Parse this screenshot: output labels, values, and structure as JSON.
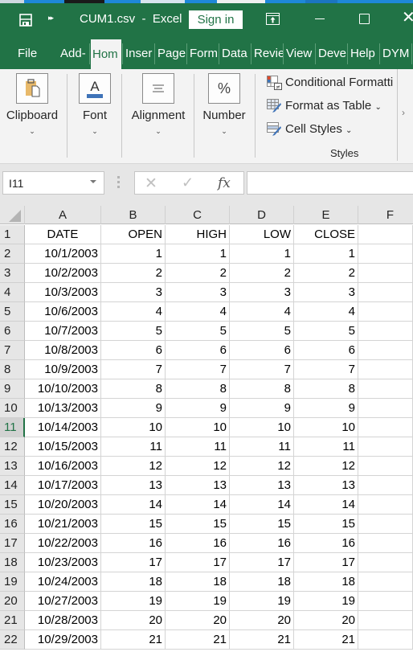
{
  "window": {
    "title": "CUM1.csv  -  Excel",
    "sign_in_label": "Sign in",
    "accent_color": "#217346"
  },
  "tabs": [
    {
      "label": "File",
      "active": false
    },
    {
      "label": "Add-",
      "active": false
    },
    {
      "label": "Hom",
      "active": true
    },
    {
      "label": "Inser",
      "active": false
    },
    {
      "label": "Page",
      "active": false
    },
    {
      "label": "Form",
      "active": false
    },
    {
      "label": "Data",
      "active": false
    },
    {
      "label": "Revie",
      "active": false
    },
    {
      "label": "View",
      "active": false
    },
    {
      "label": "Deve",
      "active": false
    },
    {
      "label": "Help",
      "active": false
    },
    {
      "label": "DYM",
      "active": false
    }
  ],
  "ribbon": {
    "groups": [
      {
        "label": "Clipboard",
        "icon": "clipboard-icon"
      },
      {
        "label": "Font",
        "icon": "font-color-icon"
      },
      {
        "label": "Alignment",
        "icon": "align-center-icon"
      },
      {
        "label": "Number",
        "icon": "percent-icon"
      }
    ],
    "styles": {
      "items": [
        {
          "label": "Conditional Formatti",
          "icon": "conditional-formatting-icon",
          "dropdown": false
        },
        {
          "label": "Format as Table",
          "icon": "format-as-table-icon",
          "dropdown": true
        },
        {
          "label": "Cell Styles",
          "icon": "cell-styles-icon",
          "dropdown": true
        }
      ],
      "group_label": "Styles"
    }
  },
  "formula_bar": {
    "name_box": "I11",
    "formula": "",
    "fx_label": "fx"
  },
  "sheet": {
    "columns": [
      "A",
      "B",
      "C",
      "D",
      "E",
      "F"
    ],
    "active_row": 11,
    "rows": [
      {
        "n": "1",
        "cells": [
          "DATE",
          "OPEN",
          "HIGH",
          "LOW",
          "CLOSE",
          ""
        ]
      },
      {
        "n": "2",
        "cells": [
          "10/1/2003",
          "1",
          "1",
          "1",
          "1",
          ""
        ]
      },
      {
        "n": "3",
        "cells": [
          "10/2/2003",
          "2",
          "2",
          "2",
          "2",
          ""
        ]
      },
      {
        "n": "4",
        "cells": [
          "10/3/2003",
          "3",
          "3",
          "3",
          "3",
          ""
        ]
      },
      {
        "n": "5",
        "cells": [
          "10/6/2003",
          "4",
          "4",
          "4",
          "4",
          ""
        ]
      },
      {
        "n": "6",
        "cells": [
          "10/7/2003",
          "5",
          "5",
          "5",
          "5",
          ""
        ]
      },
      {
        "n": "7",
        "cells": [
          "10/8/2003",
          "6",
          "6",
          "6",
          "6",
          ""
        ]
      },
      {
        "n": "8",
        "cells": [
          "10/9/2003",
          "7",
          "7",
          "7",
          "7",
          ""
        ]
      },
      {
        "n": "9",
        "cells": [
          "10/10/2003",
          "8",
          "8",
          "8",
          "8",
          ""
        ]
      },
      {
        "n": "10",
        "cells": [
          "10/13/2003",
          "9",
          "9",
          "9",
          "9",
          ""
        ]
      },
      {
        "n": "11",
        "cells": [
          "10/14/2003",
          "10",
          "10",
          "10",
          "10",
          ""
        ]
      },
      {
        "n": "12",
        "cells": [
          "10/15/2003",
          "11",
          "11",
          "11",
          "11",
          ""
        ]
      },
      {
        "n": "13",
        "cells": [
          "10/16/2003",
          "12",
          "12",
          "12",
          "12",
          ""
        ]
      },
      {
        "n": "14",
        "cells": [
          "10/17/2003",
          "13",
          "13",
          "13",
          "13",
          ""
        ]
      },
      {
        "n": "15",
        "cells": [
          "10/20/2003",
          "14",
          "14",
          "14",
          "14",
          ""
        ]
      },
      {
        "n": "16",
        "cells": [
          "10/21/2003",
          "15",
          "15",
          "15",
          "15",
          ""
        ]
      },
      {
        "n": "17",
        "cells": [
          "10/22/2003",
          "16",
          "16",
          "16",
          "16",
          ""
        ]
      },
      {
        "n": "18",
        "cells": [
          "10/23/2003",
          "17",
          "17",
          "17",
          "17",
          ""
        ]
      },
      {
        "n": "19",
        "cells": [
          "10/24/2003",
          "18",
          "18",
          "18",
          "18",
          ""
        ]
      },
      {
        "n": "20",
        "cells": [
          "10/27/2003",
          "19",
          "19",
          "19",
          "19",
          ""
        ]
      },
      {
        "n": "21",
        "cells": [
          "10/28/2003",
          "20",
          "20",
          "20",
          "20",
          ""
        ]
      },
      {
        "n": "22",
        "cells": [
          "10/29/2003",
          "21",
          "21",
          "21",
          "21",
          ""
        ]
      }
    ]
  }
}
